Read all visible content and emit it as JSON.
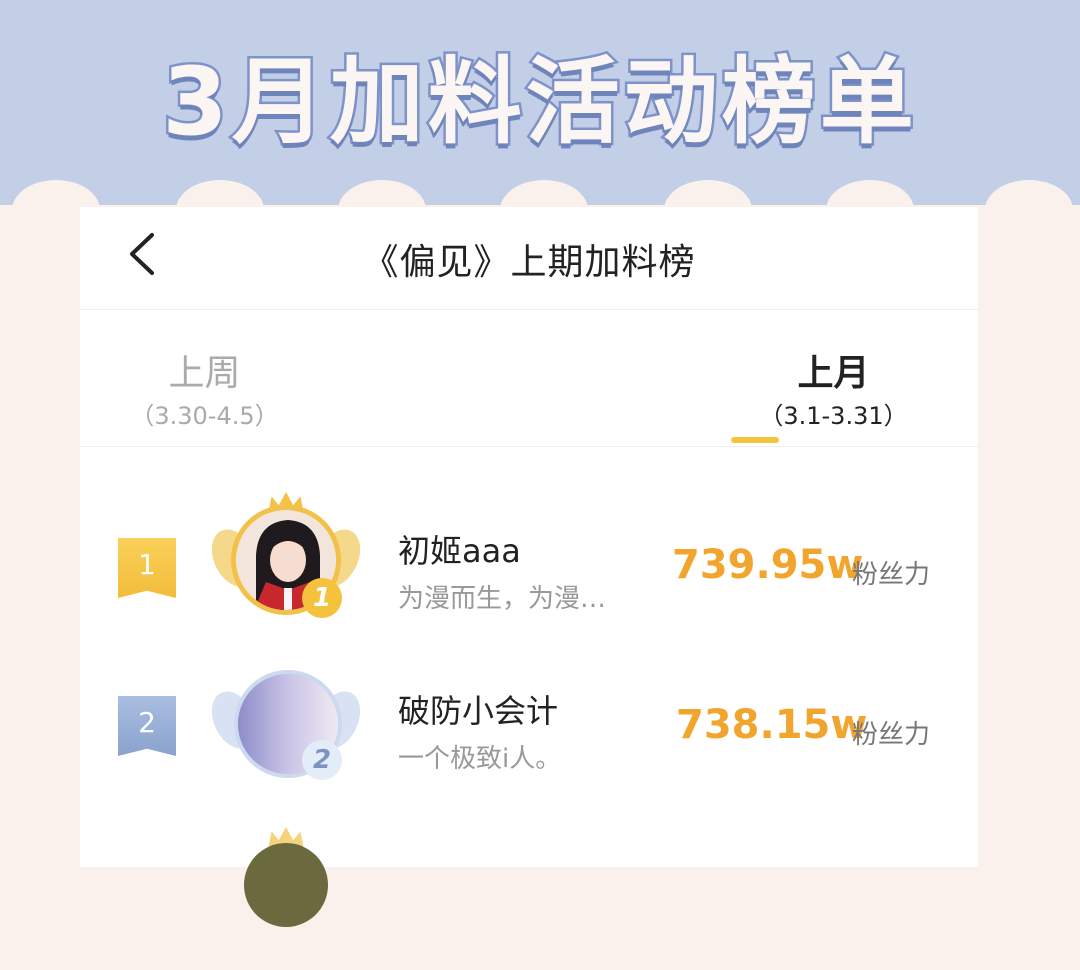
{
  "banner": {
    "title": "3月加料活动榜单"
  },
  "header": {
    "title": "《偏见》上期加料榜",
    "back_icon": "chevron-left-icon"
  },
  "tabs": [
    {
      "label": "上周",
      "range": "（3.30-4.5）",
      "active": false
    },
    {
      "label": "上月",
      "range": "（3.1-3.31）",
      "active": true
    }
  ],
  "ranking": [
    {
      "rank": "1",
      "name": "初姬aaa",
      "bio": "为漫而生，为漫…",
      "score": "739.95w",
      "unit": "粉丝力",
      "medal": "1"
    },
    {
      "rank": "2",
      "name": "破防小会计",
      "bio": "一个极致i人。",
      "score": "738.15w",
      "unit": "粉丝力",
      "medal": "2"
    }
  ],
  "colors": {
    "banner_bg": "#c3cfe6",
    "accent_gold": "#f1a52c",
    "tab_underline": "#f5c63a",
    "page_bg": "#fbf1ec"
  }
}
